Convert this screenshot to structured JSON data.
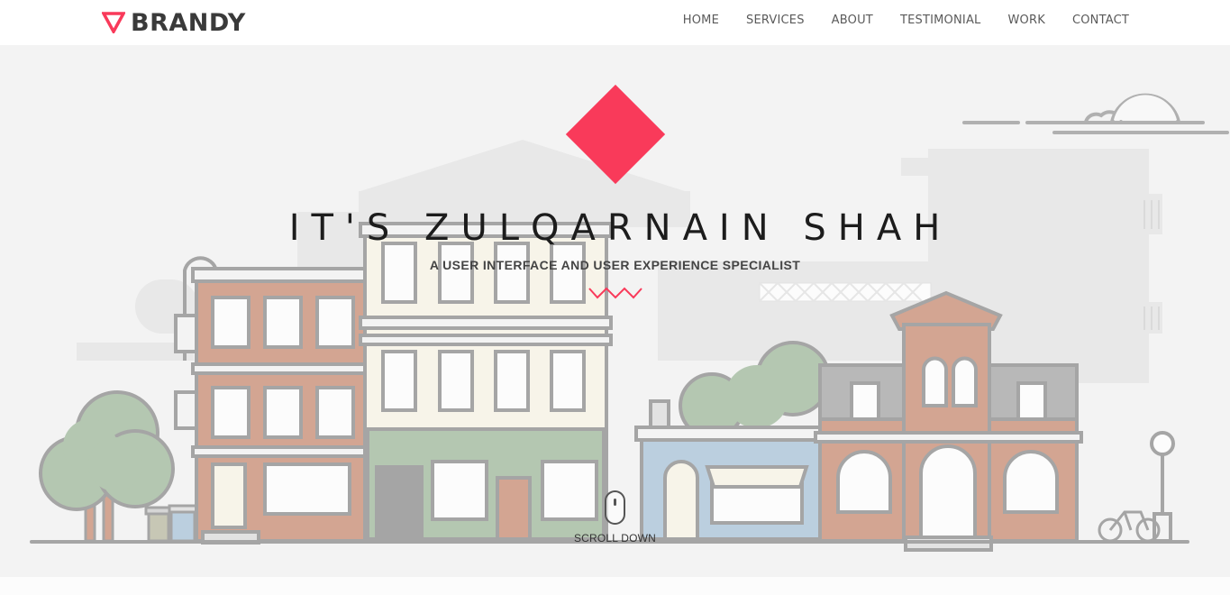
{
  "brand": {
    "name": "BRANDY",
    "accent": "#f93a5a"
  },
  "nav": {
    "items": [
      "HOME",
      "SERVICES",
      "ABOUT",
      "TESTIMONIAL",
      "WORK",
      "CONTACT"
    ]
  },
  "hero": {
    "title": "IT'S ZULQARNAIN SHAH",
    "subtitle": "A USER INTERFACE AND USER EXPERIENCE SPECIALIST",
    "scroll_label": "SCROLL DOWN",
    "illustration": "city-street-buildings",
    "colors": {
      "background": "#f3f3f3",
      "outline": "#8b8b8b",
      "brick": "#c98b72",
      "cream": "#f8f5e6",
      "green": "#9fb99b",
      "blue": "#a9c3d9"
    }
  },
  "icons": {
    "logo": "triangle-logo-icon",
    "scroll": "mouse-icon",
    "decor": "zigzag-icon"
  }
}
